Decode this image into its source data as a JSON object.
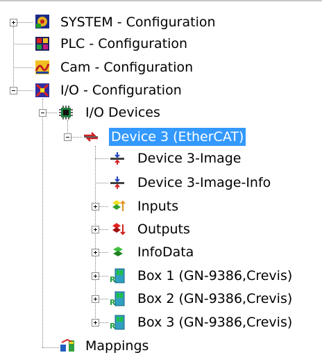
{
  "tree": {
    "system": {
      "label": "SYSTEM - Configuration",
      "icon": "system-config-icon",
      "expanded": false
    },
    "plc": {
      "label": "PLC - Configuration",
      "icon": "plc-config-icon"
    },
    "cam": {
      "label": "Cam - Configuration",
      "icon": "cam-config-icon"
    },
    "io": {
      "label": "I/O - Configuration",
      "icon": "io-config-icon",
      "expanded": true
    },
    "io_devices": {
      "label": "I/O Devices",
      "icon": "io-devices-icon",
      "expanded": true
    },
    "device3": {
      "label": "Device 3 (EtherCAT)",
      "icon": "ethercat-device-icon",
      "expanded": true,
      "selected": true
    },
    "device3_image": {
      "label": "Device 3-Image",
      "icon": "process-image-icon"
    },
    "device3_image_info": {
      "label": "Device 3-Image-Info",
      "icon": "process-image-info-icon"
    },
    "inputs": {
      "label": "Inputs",
      "icon": "inputs-icon",
      "expanded": false
    },
    "outputs": {
      "label": "Outputs",
      "icon": "outputs-icon",
      "expanded": false
    },
    "infodata": {
      "label": "InfoData",
      "icon": "infodata-icon",
      "expanded": false
    },
    "box1": {
      "label": "Box 1 (GN-9386,Crevis)",
      "icon": "box-module-icon",
      "expanded": false
    },
    "box2": {
      "label": "Box 2 (GN-9386,Crevis)",
      "icon": "box-module-icon",
      "expanded": false
    },
    "box3": {
      "label": "Box 3 (GN-9386,Crevis)",
      "icon": "box-module-icon",
      "expanded": false
    },
    "mappings": {
      "label": "Mappings",
      "icon": "mappings-icon"
    }
  },
  "colors": {
    "selection": "#3399ff",
    "selection_text": "#ffffff"
  }
}
